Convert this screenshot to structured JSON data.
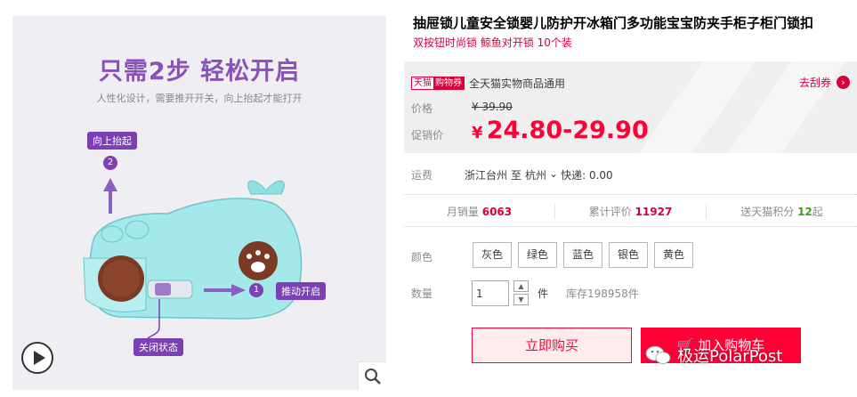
{
  "gallery": {
    "headline": "只需2步 轻松开启",
    "subline": "人性化设计，需要推开开关，向上抬起才能打开",
    "step_up_label": "向上抬起",
    "step_up_num": "2",
    "step_push_num": "1",
    "step_push_label": "推动开启",
    "closed_label": "关闭状态",
    "play_icon": "play-circle-icon",
    "zoom_icon": "magnifier-icon"
  },
  "product": {
    "title": "抽屉锁儿童安全锁婴儿防护开冰箱门多功能宝宝防夹手柜子柜门锁扣",
    "subtitle": "双按钮时尚锁 鲸鱼对开锁 10个装"
  },
  "coupon": {
    "tag_left": "天猫",
    "tag_right": "购物券",
    "text": "全天猫实物商品通用",
    "link": "去刮券"
  },
  "price": {
    "label": "价格",
    "original": "¥ 39.90",
    "promo_label": "促销价",
    "currency": "¥",
    "promo": "24.80-29.90"
  },
  "shipping": {
    "label": "运费",
    "from": "浙江台州",
    "to_word": "至",
    "to": "杭州",
    "fee": "快递: 0.00"
  },
  "stats": {
    "monthly_label": "月销量",
    "monthly_value": "6063",
    "reviews_label": "累计评价",
    "reviews_value": "11927",
    "points_label": "送天猫积分",
    "points_value": "12",
    "points_suffix": "起"
  },
  "options": {
    "color_label": "颜色",
    "colors": [
      "灰色",
      "绿色",
      "蓝色",
      "银色",
      "黄色"
    ],
    "qty_label": "数量",
    "qty_value": "1",
    "qty_unit": "件",
    "stock": "库存198958件"
  },
  "actions": {
    "buy_now": "立即购买",
    "add_cart": "加入购物车"
  },
  "watermark": "极运PolarPost",
  "colors": {
    "brand_red": "#ff0036",
    "coupon_red": "#d9003b",
    "purple": "#7d3fb5",
    "whale_teal": "#8fe0e2"
  }
}
